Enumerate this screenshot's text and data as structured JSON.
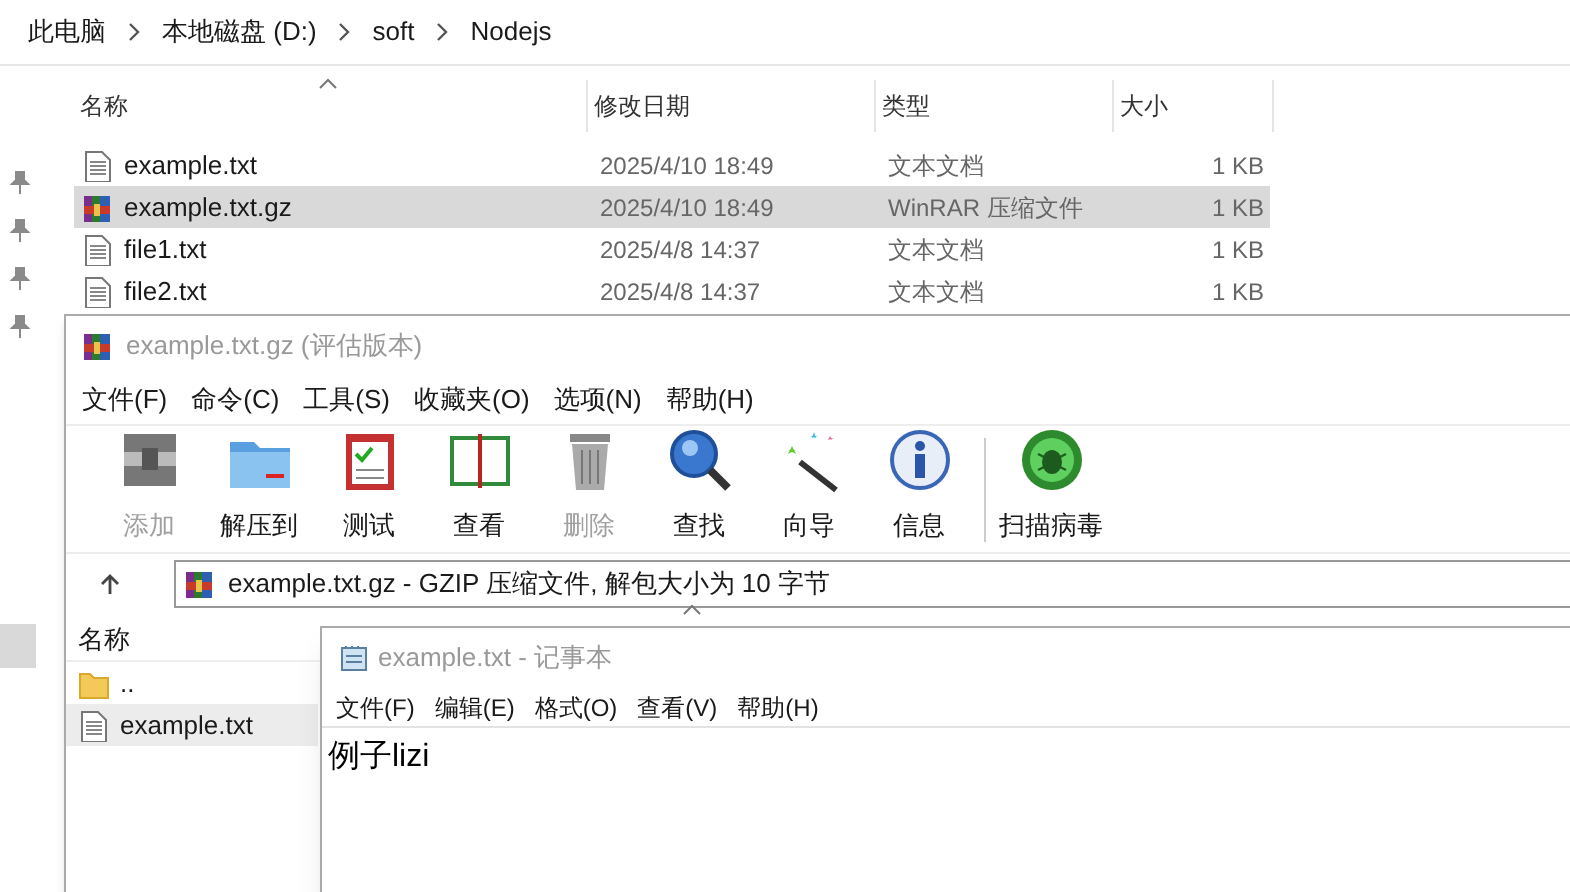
{
  "explorer": {
    "breadcrumb": [
      "此电脑",
      "本地磁盘 (D:)",
      "soft",
      "Nodejs"
    ],
    "columns": [
      "名称",
      "修改日期",
      "类型",
      "大小"
    ],
    "files": [
      {
        "name": "example.txt",
        "date": "2025/4/10 18:49",
        "type": "文本文档",
        "size": "1 KB",
        "kind": "text",
        "selected": false
      },
      {
        "name": "example.txt.gz",
        "date": "2025/4/10 18:49",
        "type": "WinRAR 压缩文件",
        "size": "1 KB",
        "kind": "archive",
        "selected": true
      },
      {
        "name": "file1.txt",
        "date": "2025/4/8 14:37",
        "type": "文本文档",
        "size": "1 KB",
        "kind": "text",
        "selected": false
      },
      {
        "name": "file2.txt",
        "date": "2025/4/8 14:37",
        "type": "文本文档",
        "size": "1 KB",
        "kind": "text",
        "selected": false
      }
    ]
  },
  "winrar": {
    "title": "example.txt.gz (评估版本)",
    "menu": [
      "文件(F)",
      "命令(C)",
      "工具(S)",
      "收藏夹(O)",
      "选项(N)",
      "帮助(H)"
    ],
    "toolbar": [
      {
        "label": "添加",
        "kind": "add",
        "disabled": true
      },
      {
        "label": "解压到",
        "kind": "extract",
        "disabled": false
      },
      {
        "label": "测试",
        "kind": "test",
        "disabled": false
      },
      {
        "label": "查看",
        "kind": "view",
        "disabled": false
      },
      {
        "label": "删除",
        "kind": "delete",
        "disabled": true
      },
      {
        "label": "查找",
        "kind": "find",
        "disabled": false
      },
      {
        "label": "向导",
        "kind": "wizard",
        "disabled": false
      },
      {
        "label": "信息",
        "kind": "info",
        "disabled": false
      },
      {
        "label": "扫描病毒",
        "kind": "scan",
        "disabled": false
      }
    ],
    "path": "example.txt.gz - GZIP 压缩文件, 解包大小为 10 字节",
    "list_column": "名称",
    "items": [
      {
        "name": "..",
        "kind": "folder",
        "selected": false
      },
      {
        "name": "example.txt",
        "kind": "text",
        "selected": true
      }
    ]
  },
  "notepad": {
    "title": "example.txt - 记事本",
    "menu": [
      "文件(F)",
      "编辑(E)",
      "格式(O)",
      "查看(V)",
      "帮助(H)"
    ],
    "content": "例子lizi"
  }
}
